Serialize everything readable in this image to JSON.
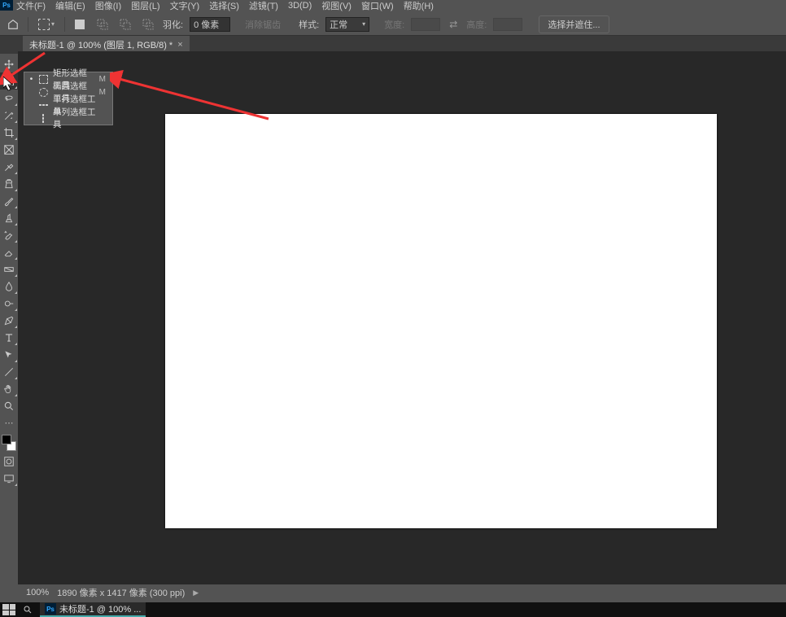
{
  "app": {
    "icon_label": "Ps"
  },
  "menu": {
    "items": [
      "文件(F)",
      "编辑(E)",
      "图像(I)",
      "图层(L)",
      "文字(Y)",
      "选择(S)",
      "滤镜(T)",
      "3D(D)",
      "视图(V)",
      "窗口(W)",
      "帮助(H)"
    ]
  },
  "options": {
    "feather_label": "羽化:",
    "feather_value": "0 像素",
    "anti_alias": "消除锯齿",
    "style_label": "样式:",
    "style_value": "正常",
    "width_label": "宽度:",
    "height_label": "高度:",
    "select_mask": "选择并遮住..."
  },
  "doc_tab": {
    "title": "未标题-1 @ 100% (图层 1, RGB/8) *",
    "close": "×"
  },
  "flyout": {
    "items": [
      {
        "label": "矩形选框工具",
        "shortcut": "M",
        "active": true
      },
      {
        "label": "椭圆选框工具",
        "shortcut": "M",
        "active": false
      },
      {
        "label": "单行选框工具",
        "shortcut": "",
        "active": false
      },
      {
        "label": "单列选框工具",
        "shortcut": "",
        "active": false
      }
    ]
  },
  "status": {
    "zoom": "100%",
    "dims": "1890 像素 x 1417 像素 (300 ppi)"
  },
  "taskbar": {
    "item_label": "未标题-1 @ 100% ..."
  },
  "tools": [
    "move-tool",
    "marquee-tool",
    "lasso-tool",
    "magic-wand-tool",
    "crop-tool",
    "frame-tool",
    "eyedropper-tool",
    "spot-heal-tool",
    "brush-tool",
    "clone-stamp-tool",
    "history-brush-tool",
    "eraser-tool",
    "gradient-tool",
    "blur-tool",
    "dodge-tool",
    "pen-tool",
    "type-tool",
    "path-select-tool",
    "rectangle-tool",
    "hand-tool",
    "zoom-tool"
  ]
}
